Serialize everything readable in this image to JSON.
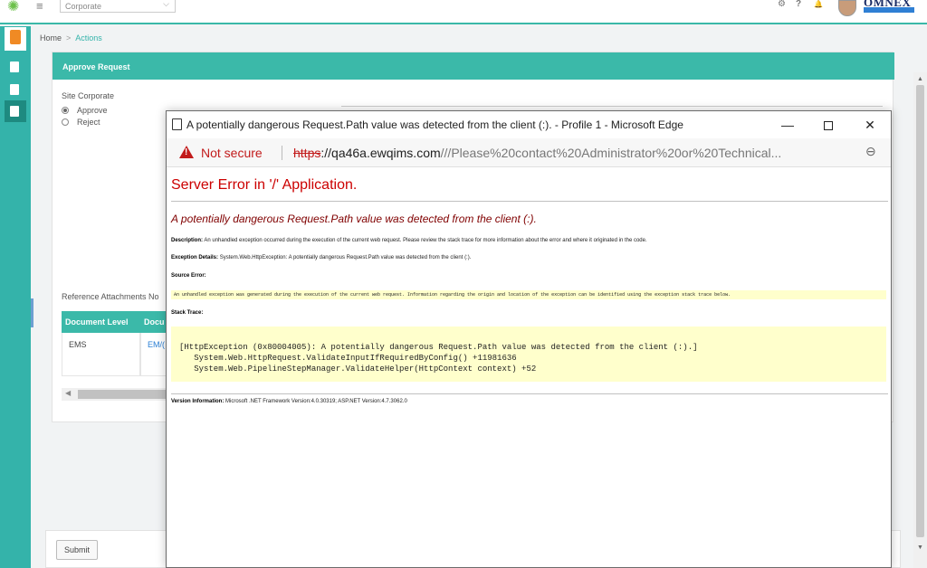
{
  "topbar": {
    "site_select_value": "Corporate",
    "brand": "OMNEX"
  },
  "breadcrumb": {
    "home": "Home",
    "separator": ">",
    "current": "Actions"
  },
  "panel": {
    "title": "Approve Request",
    "site_label": "Site Corporate",
    "options": [
      {
        "label": "Approve",
        "selected": true
      },
      {
        "label": "Reject",
        "selected": false
      }
    ],
    "reference_label": "Reference Attachments No",
    "table": {
      "headers": [
        "Document Level",
        "Docu"
      ],
      "rows": [
        [
          "EMS",
          "EM/("
        ]
      ]
    }
  },
  "submit_label": "Submit",
  "edge_window": {
    "title": "A potentially dangerous Request.Path value was detected from the client (:). - Profile 1 - Microsoft Edge",
    "minimize_glyph": "—",
    "close_glyph": "✕",
    "not_secure": "Not secure",
    "url_scheme": "https",
    "url_host": "://qa46a.ewqims.com",
    "url_path": "///Please%20contact%20Administrator%20or%20Technical...",
    "error": {
      "title": "Server Error in '/' Application.",
      "subtitle": "A potentially dangerous Request.Path value was detected from the client (:).",
      "description_label": "Description:",
      "description": "An unhandled exception occurred during the execution of the current web request. Please review the stack trace for more information about the error and where it originated in the code.",
      "exception_label": "Exception Details:",
      "exception": "System.Web.HttpException: A potentially dangerous Request.Path value was detected from the client (:).",
      "source_label": "Source Error:",
      "source": "An unhandled exception was generated during the execution of the current web request. Information regarding the origin and location of the exception can be identified using the exception stack trace below.",
      "stack_label": "Stack Trace:",
      "stack": "[HttpException (0x80004005): A potentially dangerous Request.Path value was detected from the client (:).]\n   System.Web.HttpRequest.ValidateInputIfRequiredByConfig() +11981636\n   System.Web.PipelineStepManager.ValidateHelper(HttpContext context) +52",
      "version_label": "Version Information:",
      "version": "Microsoft .NET Framework Version:4.0.30319; ASP.NET Version:4.7.3062.0"
    }
  },
  "icons": {
    "gear": "⚙",
    "help": "?",
    "bell": "🔔",
    "hamburger": "≡",
    "chevron_down": "⌵",
    "zoom": "⊖"
  },
  "colors": {
    "accent": "#3bb9a9",
    "sidebar": "#34b3aa",
    "error_red": "#cc0000",
    "not_secure": "#c21b1b",
    "source_bg": "#ffffcc"
  }
}
